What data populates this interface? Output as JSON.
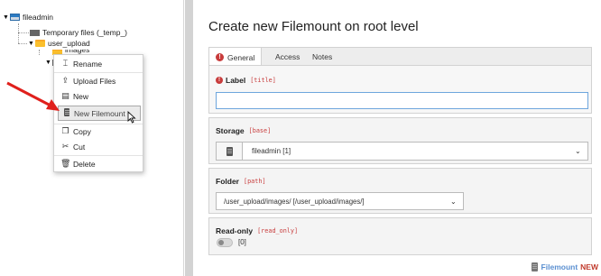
{
  "tree": {
    "root": "fileadmin",
    "items": [
      {
        "label": "Temporary files (_temp_)"
      },
      {
        "label": "user_upload"
      },
      {
        "label": "images"
      }
    ]
  },
  "context_menu": {
    "items": [
      {
        "label": "Rename",
        "icon": "rename-icon"
      },
      {
        "label": "Upload Files",
        "icon": "upload-icon"
      },
      {
        "label": "New",
        "icon": "new-file-icon"
      },
      {
        "label": "New Filemount",
        "icon": "filemount-icon"
      },
      {
        "label": "Copy",
        "icon": "copy-icon"
      },
      {
        "label": "Cut",
        "icon": "scissors-icon"
      },
      {
        "label": "Delete",
        "icon": "trash-icon"
      }
    ]
  },
  "form": {
    "title": "Create new Filemount on root level",
    "tabs": [
      {
        "label": "General"
      },
      {
        "label": "Access"
      },
      {
        "label": "Notes"
      }
    ],
    "label_field": {
      "label": "Label",
      "code": "[title]",
      "value": ""
    },
    "storage_field": {
      "label": "Storage",
      "code": "[base]",
      "value": "fileadmin [1]"
    },
    "folder_field": {
      "label": "Folder",
      "code": "[path]",
      "value": "/user_upload/images/ [/user_upload/images/]"
    },
    "readonly_field": {
      "label": "Read-only",
      "code": "[read_only]",
      "value": "[0]"
    }
  },
  "footer": {
    "title": "Filemount",
    "badge": "NEW"
  },
  "colors": {
    "accent": "#c83c3c",
    "link": "#5a8fd1",
    "input_focus": "#6ea6dd"
  }
}
